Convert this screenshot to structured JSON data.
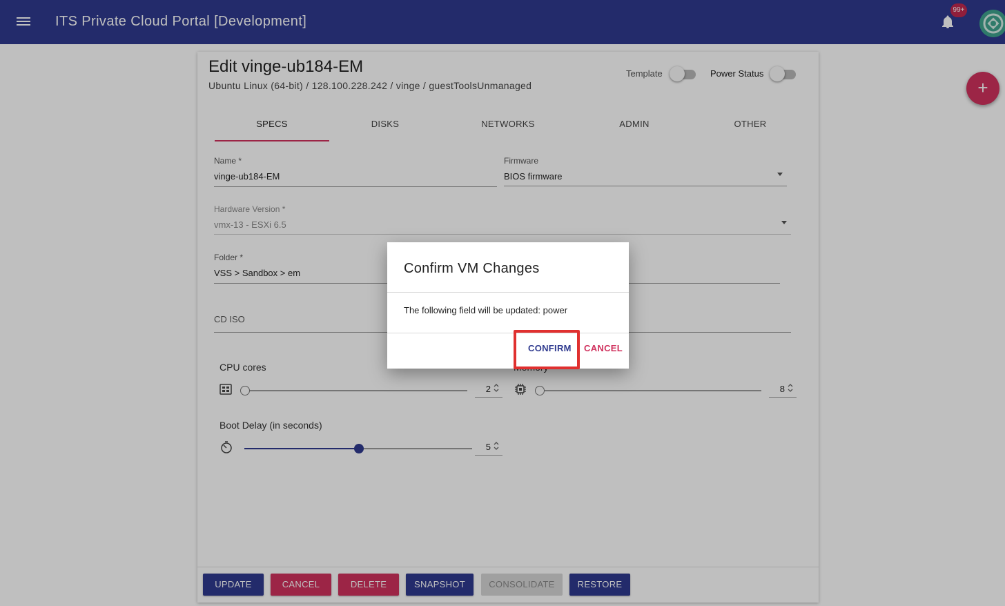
{
  "app": {
    "title": "ITS Private Cloud Portal [Development]",
    "notification_count": "99+"
  },
  "vm": {
    "title": "Edit vinge-ub184-EM",
    "subtitle": "Ubuntu Linux (64-bit) / 128.100.228.242 / vinge / guestToolsUnmanaged"
  },
  "toggles": {
    "template_label": "Template",
    "template_on": false,
    "power_label": "Power Status",
    "power_on": false
  },
  "tabs": [
    {
      "label": "SPECS",
      "active": true
    },
    {
      "label": "DISKS",
      "active": false
    },
    {
      "label": "NETWORKS",
      "active": false
    },
    {
      "label": "ADMIN",
      "active": false
    },
    {
      "label": "OTHER",
      "active": false
    }
  ],
  "form": {
    "name": {
      "label": "Name *",
      "value": "vinge-ub184-EM"
    },
    "firmware": {
      "label": "Firmware",
      "value": "BIOS firmware"
    },
    "hardware_version": {
      "label": "Hardware Version *",
      "value": "vmx-13 - ESXi 6.5"
    },
    "folder": {
      "label": "Folder *",
      "value": "VSS > Sandbox > em"
    },
    "cd_iso": {
      "label": "CD ISO",
      "value": ""
    }
  },
  "sliders": {
    "cpu": {
      "label": "CPU cores",
      "value": "2",
      "level": 0
    },
    "memory": {
      "label": "Memory",
      "value": "8",
      "level": 0
    },
    "boot_delay": {
      "label": "Boot Delay (in seconds)",
      "value": "5",
      "level": 0.5
    }
  },
  "actions": {
    "update": "UPDATE",
    "cancel": "CANCEL",
    "delete": "DELETE",
    "snapshot": "SNAPSHOT",
    "consolidate": "CONSOLIDATE",
    "restore": "RESTORE"
  },
  "fab_label": "+",
  "dialog": {
    "title": "Confirm VM Changes",
    "message": "The following field will be updated: power",
    "confirm": "CONFIRM",
    "cancel": "CANCEL"
  },
  "colors": {
    "primary": "#2f3a8f",
    "accent": "#d0325e",
    "highlight": "#e0302f"
  }
}
